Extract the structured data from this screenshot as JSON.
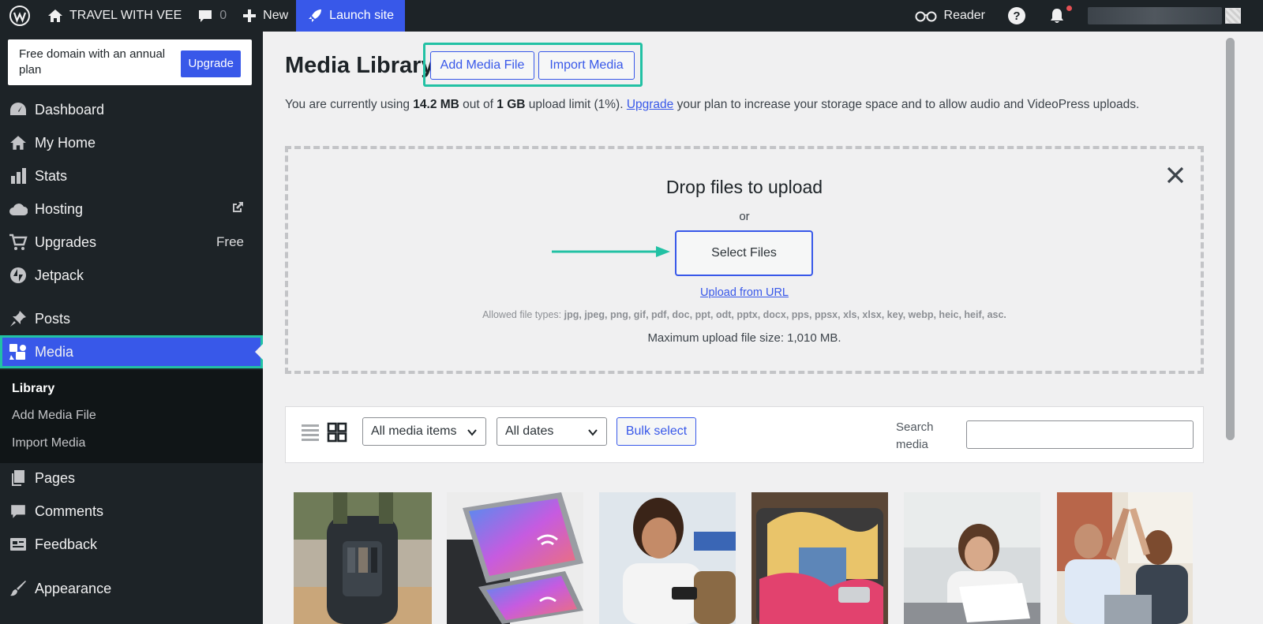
{
  "admin_bar": {
    "site_name": "TRAVEL WITH VEE",
    "comments_count": "0",
    "new_label": "New",
    "launch_label": "Launch site",
    "reader_label": "Reader"
  },
  "sidebar": {
    "upsell_text": "Free domain with an annual plan",
    "upsell_button": "Upgrade",
    "items": [
      {
        "label": "Dashboard",
        "icon": "dashboard-icon"
      },
      {
        "label": "My Home",
        "icon": "home-icon"
      },
      {
        "label": "Stats",
        "icon": "stats-icon"
      },
      {
        "label": "Hosting",
        "icon": "cloud-icon"
      },
      {
        "label": "Upgrades",
        "icon": "cart-icon",
        "badge": "Free"
      },
      {
        "label": "Jetpack",
        "icon": "jetpack-icon"
      },
      {
        "label": "Posts",
        "icon": "pin-icon"
      },
      {
        "label": "Media",
        "icon": "media-icon"
      },
      {
        "label": "Pages",
        "icon": "pages-icon"
      },
      {
        "label": "Comments",
        "icon": "comment-icon"
      },
      {
        "label": "Feedback",
        "icon": "feedback-icon"
      },
      {
        "label": "Appearance",
        "icon": "brush-icon"
      }
    ],
    "submenu": [
      "Library",
      "Add Media File",
      "Import Media"
    ]
  },
  "main": {
    "title": "Media Library",
    "add_media_button": "Add Media File",
    "import_media_button": "Import Media",
    "usage": {
      "prefix": "You are currently using ",
      "used": "14.2 MB",
      "middle": " out of ",
      "limit": "1 GB",
      "suffix_before_link": " upload limit (1%). ",
      "link": "Upgrade",
      "suffix": " your plan to increase your storage space and to allow audio and VideoPress uploads."
    },
    "dropzone": {
      "title": "Drop files to upload",
      "or": "or",
      "select_button": "Select Files",
      "upload_url": "Upload from URL",
      "allowed_prefix": "Allowed file types: ",
      "allowed_types": "jpg, jpeg, png, gif, pdf, doc, ppt, odt, pptx, docx, pps, ppsx, xls, xlsx, key, webp, heic, heif, asc.",
      "max_size": "Maximum upload file size: 1,010 MB."
    },
    "toolbar": {
      "filter_type": "All media items",
      "filter_date": "All dates",
      "bulk_select": "Bulk select",
      "search_label": "Search media"
    }
  },
  "colors": {
    "accent": "#3858e9",
    "highlight": "#22c1a4",
    "admin_bg": "#1d2327"
  }
}
